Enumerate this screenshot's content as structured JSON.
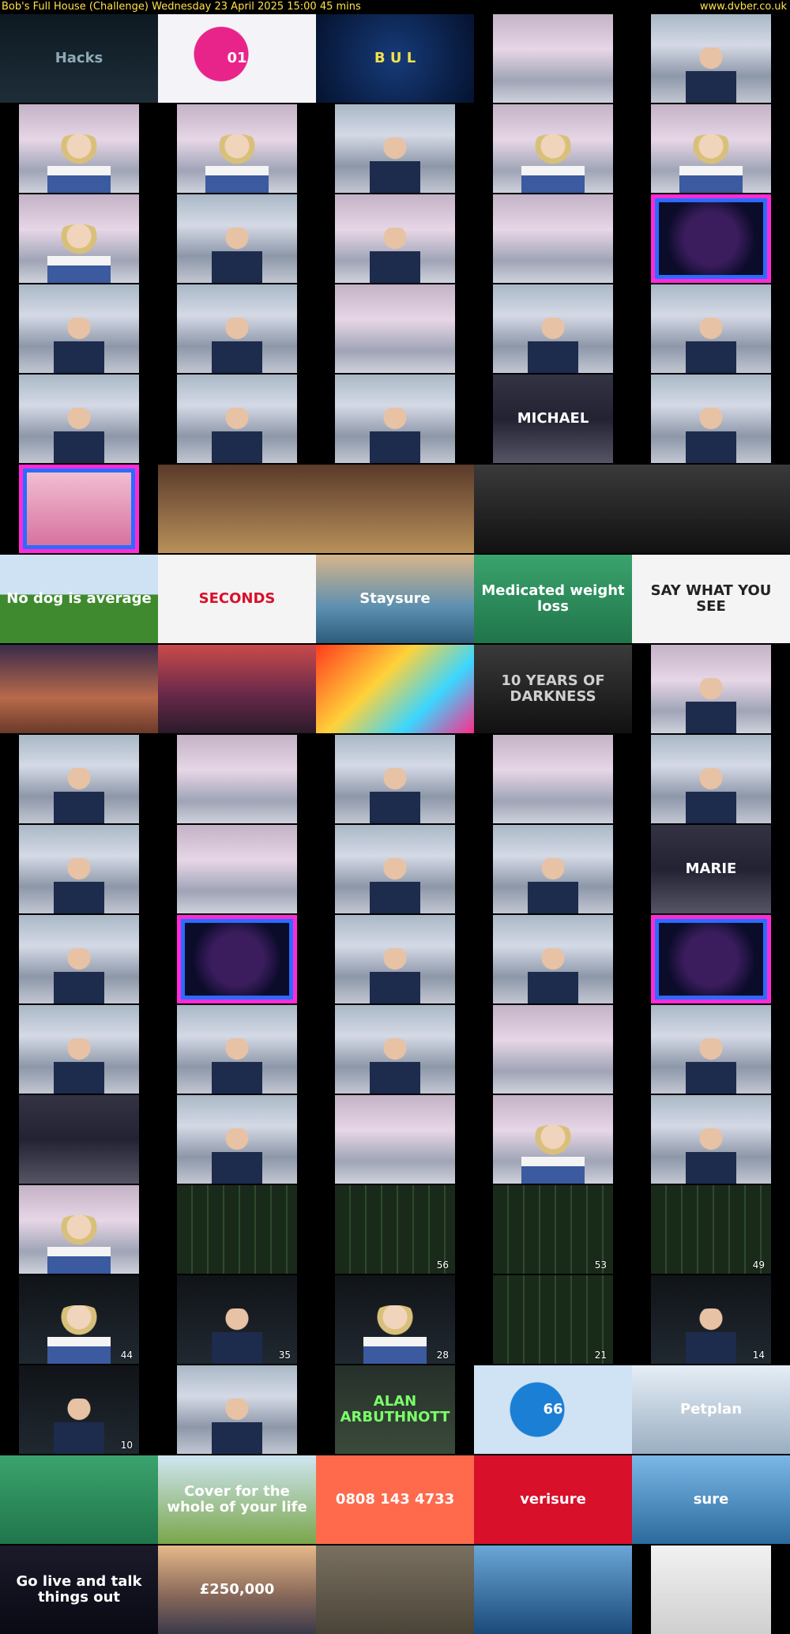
{
  "header": {
    "title": "Bob's Full House (Challenge)    Wednesday 23 April 2025  15:00  45 mins",
    "site": "www.dvber.co.uk"
  },
  "thumbnails": [
    {
      "style": "ad-hacks",
      "frame": "full",
      "caption": "Hacks",
      "color": "#8fa9b6"
    },
    {
      "style": "ad-lotto",
      "frame": "full",
      "caption": "01",
      "color": "#ffffff"
    },
    {
      "style": "ad-words",
      "frame": "full",
      "caption": "B U L",
      "color": "#f5e04a"
    },
    {
      "style": "studio-pink",
      "frame": "pillar"
    },
    {
      "style": "studio",
      "frame": "pillar",
      "figure": "host"
    },
    {
      "style": "studio-pink",
      "frame": "pillar",
      "figure": "girl"
    },
    {
      "style": "studio-pink",
      "frame": "pillar",
      "figure": "girl"
    },
    {
      "style": "studio",
      "frame": "pillar",
      "figure": "host"
    },
    {
      "style": "studio-pink",
      "frame": "pillar",
      "figure": "girl"
    },
    {
      "style": "studio-pink",
      "frame": "pillar",
      "figure": "girl"
    },
    {
      "style": "studio-pink",
      "frame": "pillar",
      "figure": "girl"
    },
    {
      "style": "studio",
      "frame": "pillar",
      "figure": "host"
    },
    {
      "style": "studio-pink",
      "frame": "pillar",
      "figure": "host"
    },
    {
      "style": "studio-pink",
      "frame": "pillar"
    },
    {
      "style": "neon",
      "frame": "pillar"
    },
    {
      "style": "studio",
      "frame": "pillar",
      "figure": "host"
    },
    {
      "style": "studio",
      "frame": "pillar",
      "figure": "host"
    },
    {
      "style": "studio-pink",
      "frame": "pillar"
    },
    {
      "style": "studio",
      "frame": "pillar",
      "figure": "host"
    },
    {
      "style": "studio",
      "frame": "pillar",
      "figure": "host"
    },
    {
      "style": "studio",
      "frame": "pillar",
      "figure": "host"
    },
    {
      "style": "studio",
      "frame": "pillar",
      "figure": "host"
    },
    {
      "style": "studio",
      "frame": "pillar",
      "figure": "host"
    },
    {
      "style": "board",
      "frame": "pillar",
      "caption": "MICHAEL",
      "color": "#ffffff"
    },
    {
      "style": "studio",
      "frame": "pillar",
      "figure": "host"
    },
    {
      "style": "ad-pink",
      "frame": "pillar"
    },
    {
      "style": "ad-warm",
      "frame": "full"
    },
    {
      "style": "ad-warm",
      "frame": "full"
    },
    {
      "style": "ad-gray",
      "frame": "full"
    },
    {
      "style": "ad-gray",
      "frame": "full"
    },
    {
      "style": "ad-field",
      "frame": "full",
      "caption": "No dog is average",
      "color": "#ffffff"
    },
    {
      "style": "ad-white",
      "frame": "full",
      "caption": "SECONDS",
      "color": "#d8102a"
    },
    {
      "style": "ad-coast",
      "frame": "full",
      "caption": "Staysure",
      "color": "#ffffff"
    },
    {
      "style": "ad-green",
      "frame": "full",
      "caption": "Medicated weight loss",
      "color": "#ffffff"
    },
    {
      "style": "ad-white",
      "frame": "full",
      "caption": "SAY WHAT YOU SEE",
      "color": "#222222"
    },
    {
      "style": "ad-sunset",
      "frame": "full"
    },
    {
      "style": "ad-castle",
      "frame": "full"
    },
    {
      "style": "ad-game",
      "frame": "full"
    },
    {
      "style": "ad-gray",
      "frame": "full",
      "caption": "10 YEARS OF DARKNESS",
      "color": "#cfcfcf"
    },
    {
      "style": "studio-pink",
      "frame": "pillar",
      "figure": "host"
    },
    {
      "style": "studio",
      "frame": "pillar",
      "figure": "host"
    },
    {
      "style": "studio-pink",
      "frame": "pillar"
    },
    {
      "style": "studio",
      "frame": "pillar",
      "figure": "host"
    },
    {
      "style": "studio-pink",
      "frame": "pillar"
    },
    {
      "style": "studio",
      "frame": "pillar",
      "figure": "host"
    },
    {
      "style": "studio",
      "frame": "pillar",
      "figure": "host"
    },
    {
      "style": "studio-pink",
      "frame": "pillar"
    },
    {
      "style": "studio",
      "frame": "pillar",
      "figure": "host"
    },
    {
      "style": "studio",
      "frame": "pillar",
      "figure": "host"
    },
    {
      "style": "board",
      "frame": "pillar",
      "caption": "MARIE",
      "color": "#ffffff"
    },
    {
      "style": "studio",
      "frame": "pillar",
      "figure": "host"
    },
    {
      "style": "neon",
      "frame": "pillar"
    },
    {
      "style": "studio",
      "frame": "pillar",
      "figure": "host"
    },
    {
      "style": "studio",
      "frame": "pillar",
      "figure": "host"
    },
    {
      "style": "neon",
      "frame": "pillar"
    },
    {
      "style": "studio",
      "frame": "pillar",
      "figure": "host"
    },
    {
      "style": "studio",
      "frame": "pillar",
      "figure": "host"
    },
    {
      "style": "studio",
      "frame": "pillar",
      "figure": "host"
    },
    {
      "style": "studio-pink",
      "frame": "pillar"
    },
    {
      "style": "studio",
      "frame": "pillar",
      "figure": "host"
    },
    {
      "style": "board",
      "frame": "pillar"
    },
    {
      "style": "studio",
      "frame": "pillar",
      "figure": "host"
    },
    {
      "style": "studio-pink",
      "frame": "pillar"
    },
    {
      "style": "studio-pink",
      "frame": "pillar",
      "figure": "girl"
    },
    {
      "style": "studio",
      "frame": "pillar",
      "figure": "host"
    },
    {
      "style": "studio-pink",
      "frame": "pillar",
      "figure": "girl"
    },
    {
      "style": "scoreboard",
      "frame": "pillar"
    },
    {
      "style": "scoreboard",
      "frame": "pillar",
      "number": "56"
    },
    {
      "style": "scoreboard",
      "frame": "pillar",
      "number": "53"
    },
    {
      "style": "scoreboard",
      "frame": "pillar",
      "number": "49"
    },
    {
      "style": "dark",
      "frame": "pillar",
      "figure": "girl",
      "number": "44"
    },
    {
      "style": "dark",
      "frame": "pillar",
      "figure": "host",
      "number": "35"
    },
    {
      "style": "dark",
      "frame": "pillar",
      "figure": "girl",
      "number": "28"
    },
    {
      "style": "scoreboard",
      "frame": "pillar",
      "number": "21"
    },
    {
      "style": "dark",
      "frame": "pillar",
      "figure": "host",
      "number": "14"
    },
    {
      "style": "dark",
      "frame": "pillar",
      "figure": "host",
      "number": "10"
    },
    {
      "style": "studio",
      "frame": "pillar",
      "figure": "host"
    },
    {
      "style": "ad-ink",
      "frame": "pillar",
      "caption": "ALAN ARBUTHNOTT",
      "color": "#7cff6a"
    },
    {
      "style": "ad-lotto2",
      "frame": "full",
      "caption": "66",
      "color": "#ffffff"
    },
    {
      "style": "ad-petplan",
      "frame": "full",
      "caption": "Petplan",
      "color": "#ffffff"
    },
    {
      "style": "ad-green",
      "frame": "full"
    },
    {
      "style": "ad-cover",
      "frame": "full",
      "caption": "Cover for the whole of your life",
      "color": "#ffffff"
    },
    {
      "style": "ad-orange",
      "frame": "full",
      "caption": "0808 143 4733",
      "color": "#ffffff"
    },
    {
      "style": "ad-red",
      "frame": "full",
      "caption": "verisure",
      "color": "#ffffff"
    },
    {
      "style": "ad-sky",
      "frame": "full",
      "caption": "sure",
      "color": "#ffffff"
    },
    {
      "style": "ad-phone",
      "frame": "full",
      "caption": "Go live and talk things out",
      "color": "#ffffff"
    },
    {
      "style": "ad-city",
      "frame": "full",
      "caption": "£250,000",
      "color": "#ffffff"
    },
    {
      "style": "ad-car",
      "frame": "full"
    },
    {
      "style": "ad-sea",
      "frame": "full"
    },
    {
      "style": "ad-selfie",
      "frame": "pillar"
    }
  ]
}
